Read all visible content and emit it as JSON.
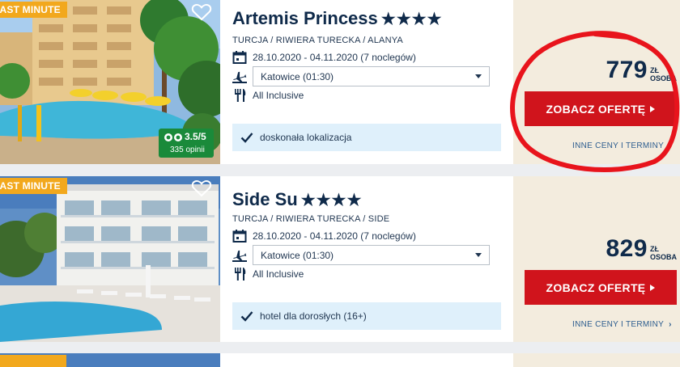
{
  "hotels": [
    {
      "badge": "LAST MINUTE",
      "name": "Artemis Princess",
      "stars": "★★★★",
      "location": "TURCJA / RIWIERA TURECKA / ALANYA",
      "dates": "28.10.2020 - 04.11.2020 (7 noclegów)",
      "airport": "Katowice (01:30)",
      "board": "All Inclusive",
      "feature": "doskonała lokalizacja",
      "rating": "3.5/5",
      "reviews": "335 opinii",
      "price": "779",
      "currency": "ZŁ",
      "per": "OSOBA",
      "cta": "ZOBACZ OFERTĘ",
      "more": "INNE CENY I TERMINY"
    },
    {
      "badge": "LAST MINUTE",
      "name": "Side Su",
      "stars": "★★★★",
      "location": "TURCJA / RIWIERA TURECKA / SIDE",
      "dates": "28.10.2020 - 04.11.2020 (7 noclegów)",
      "airport": "Katowice (01:30)",
      "board": "All Inclusive",
      "feature": "hotel dla dorosłych (16+)",
      "price": "829",
      "currency": "ZŁ",
      "per": "OSOBA",
      "cta": "ZOBACZ OFERTĘ",
      "more": "INNE CENY I TERMINY"
    }
  ],
  "colors": {
    "navy": "#0f2a4a",
    "cta_red": "#d0141c",
    "badge_orange": "#f2a81d",
    "feature_blue": "#dff0fb",
    "price_bg": "#f3ecde",
    "annotation_red": "#e8141c"
  },
  "icons": [
    "heart-icon",
    "calendar-icon",
    "plane-icon",
    "cutlery-icon",
    "check-icon",
    "tripadvisor-icon",
    "chevron-right-icon"
  ]
}
